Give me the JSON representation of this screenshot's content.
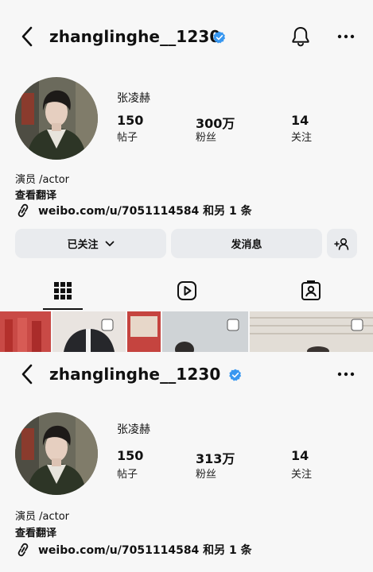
{
  "colors": {
    "verified": "#3897f0",
    "background": "#f7f7f7",
    "button": "#e9ebee"
  },
  "icons": [
    "back-arrow-icon",
    "verified-badge-icon",
    "bell-icon",
    "more-icon",
    "link-icon",
    "chevron-down-icon",
    "add-person-icon",
    "grid-icon",
    "reels-icon",
    "tagged-icon"
  ],
  "top": {
    "username": "zhanglinghe__1230",
    "display_name": "张凌赫",
    "stats": [
      {
        "value": "150",
        "label": "帖子"
      },
      {
        "value": "300万",
        "label": "粉丝"
      },
      {
        "value": "14",
        "label": "关注"
      }
    ],
    "bio": "演员 /actor",
    "translate": "查看翻译",
    "link": "weibo.com/u/7051114584 和另 1 条",
    "following_button": "已关注",
    "message_button": "发消息"
  },
  "bottom": {
    "username": "zhanglinghe__1230",
    "display_name": "张凌赫",
    "stats": [
      {
        "value": "150",
        "label": "帖子"
      },
      {
        "value": "313万",
        "label": "粉丝"
      },
      {
        "value": "14",
        "label": "关注"
      }
    ],
    "bio": "演员 /actor",
    "translate": "查看翻译",
    "link": "weibo.com/u/7051114584 和另 1 条"
  }
}
